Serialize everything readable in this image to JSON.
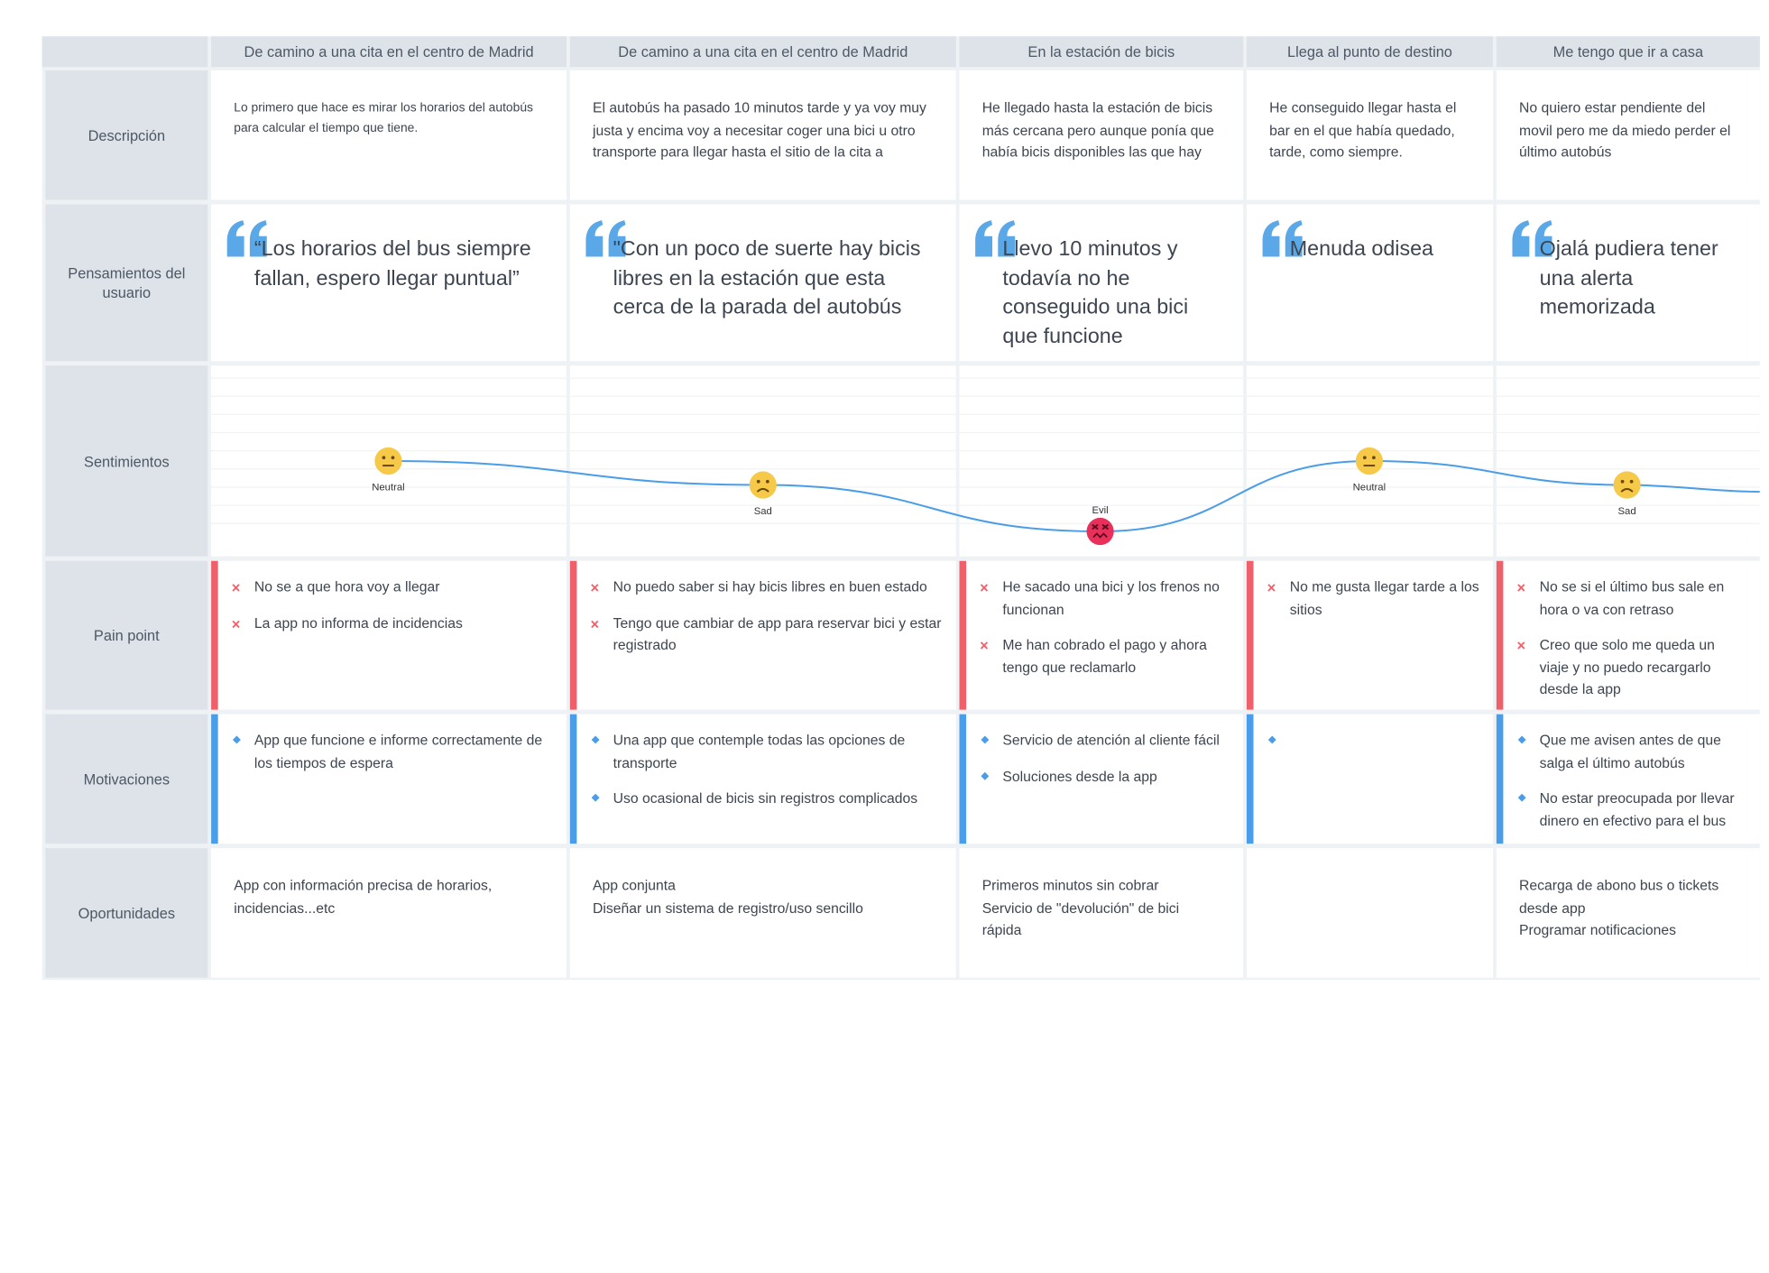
{
  "colors": {
    "pain_bar": "#f0606a",
    "motivation_bar": "#4a9de8",
    "quote": "#5aa8e8",
    "curve": "#4a9de8",
    "face_neutral": "#f7c948",
    "face_evil": "#e8305a"
  },
  "row_labels": {
    "descripcion": "Descripción",
    "pensamientos": "Pensamientos del usuario",
    "sentimientos": "Sentimientos",
    "pain": "Pain point",
    "motivaciones": "Motivaciones",
    "oportunidades": "Oportunidades"
  },
  "stages": [
    {
      "title": "De camino a una cita en el centro de Madrid",
      "description": "Lo primero que hace es mirar los horarios del autobús para calcular el tiempo que tiene.",
      "thought": "“Los horarios del bus siempre fallan, espero llegar puntual”",
      "feeling": "Neutral",
      "feeling_level": 0.5,
      "pains": [
        "No se a que hora voy a llegar",
        "La app no informa de incidencias"
      ],
      "motivations": [
        "App que funcione e informe correctamente de los tiempos de espera"
      ],
      "opportunities": [
        "App con información precisa de horarios,",
        "incidencias...etc"
      ]
    },
    {
      "title": "De camino a una cita en el centro de Madrid",
      "description": "El autobús ha pasado 10 minutos tarde y ya voy muy justa y encima voy a necesitar coger una bici u otro transporte para llegar hasta el sitio de la cita a",
      "thought": "\"Con un poco de suerte hay bicis libres en la estación que esta cerca de la parada del autobús",
      "feeling": "Sad",
      "feeling_level": 0.33,
      "pains": [
        "No puedo saber si hay bicis libres en buen estado",
        "Tengo que cambiar de app para reservar bici y estar registrado"
      ],
      "motivations": [
        "Una app que contemple todas las opciones de transporte",
        "Uso ocasional de bicis sin registros complicados"
      ],
      "opportunities": [
        "App conjunta",
        "Diseñar un sistema de registro/uso sencillo"
      ]
    },
    {
      "title": "En la estación de bicis",
      "description": "He llegado hasta la estación de bicis más cercana pero aunque ponía que había bicis disponibles las que hay",
      "thought": "Llevo 10 minutos y todavía no he conseguido una bici que funcione",
      "feeling": "Evil",
      "feeling_level": 0.0,
      "pains": [
        "He sacado una bici y los frenos no funcionan",
        "Me han cobrado el pago y ahora tengo que reclamarlo"
      ],
      "motivations": [
        "Servicio de atención al cliente fácil",
        "Soluciones desde la app"
      ],
      "opportunities": [
        "Primeros minutos sin cobrar",
        "Servicio de \"devolución\" de bici",
        "rápida"
      ]
    },
    {
      "title": "Llega al punto de destino",
      "description": "He conseguido llegar hasta el bar en el que había quedado, tarde, como siempre.",
      "thought": "Menuda odisea",
      "feeling": "Neutral",
      "feeling_level": 0.5,
      "pains": [
        "No me gusta llegar tarde a los sitios"
      ],
      "motivations": [
        ""
      ],
      "opportunities": []
    },
    {
      "title": "Me tengo que ir a casa",
      "description": "No quiero estar pendiente del movil pero me da miedo perder el último autobús",
      "thought": "Ojalá pudiera tener una alerta memorizada",
      "feeling": "Sad",
      "feeling_level": 0.33,
      "pains": [
        "No se si el último bus sale en hora o va con retraso",
        "Creo que solo me queda un viaje y no puedo recargarlo desde la app"
      ],
      "motivations": [
        "Que me avisen antes de que salga el último autobús",
        "No estar preocupada por llevar dinero en efectivo para el bus"
      ],
      "opportunities": [
        "Recarga de abono bus o tickets",
        "desde app",
        "Programar notificaciones"
      ]
    }
  ]
}
